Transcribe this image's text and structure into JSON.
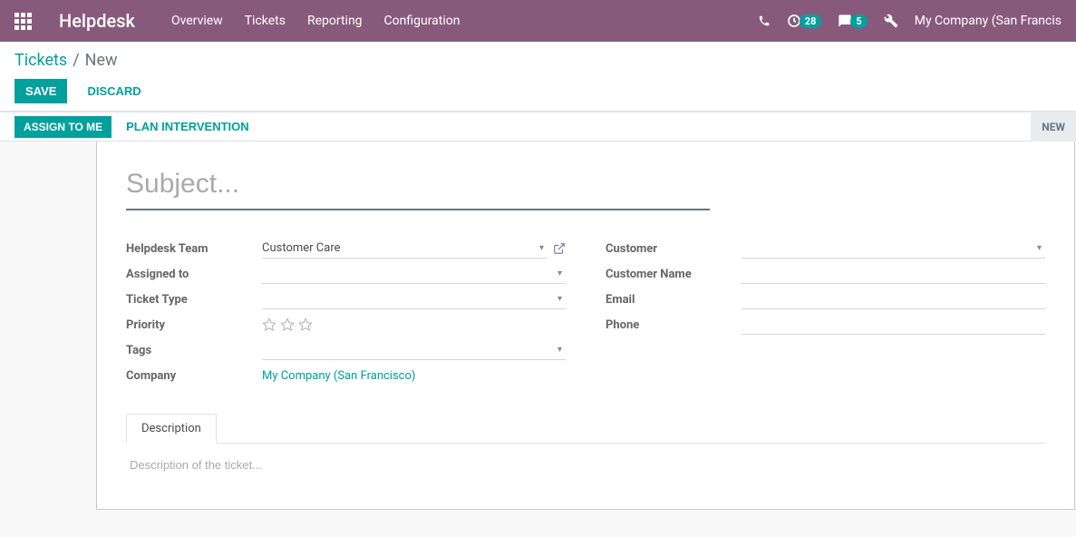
{
  "nav": {
    "brand": "Helpdesk",
    "links": [
      "Overview",
      "Tickets",
      "Reporting",
      "Configuration"
    ],
    "activity_count": "28",
    "discuss_count": "5",
    "company": "My Company (San Francis"
  },
  "breadcrumb": {
    "parent": "Tickets",
    "sep": "/",
    "current": "New"
  },
  "buttons": {
    "save": "Save",
    "discard": "Discard",
    "assign": "Assign to Me",
    "plan": "Plan Intervention"
  },
  "stage": {
    "new": "NEW"
  },
  "form": {
    "subject_placeholder": "Subject...",
    "labels": {
      "helpdesk_team": "Helpdesk Team",
      "assigned_to": "Assigned to",
      "ticket_type": "Ticket Type",
      "priority": "Priority",
      "tags": "Tags",
      "company": "Company",
      "customer": "Customer",
      "customer_name": "Customer Name",
      "email": "Email",
      "phone": "Phone"
    },
    "values": {
      "helpdesk_team": "Customer Care",
      "company": "My Company (San Francisco)"
    },
    "tabs": {
      "description": "Description"
    },
    "description_placeholder": "Description of the ticket..."
  }
}
